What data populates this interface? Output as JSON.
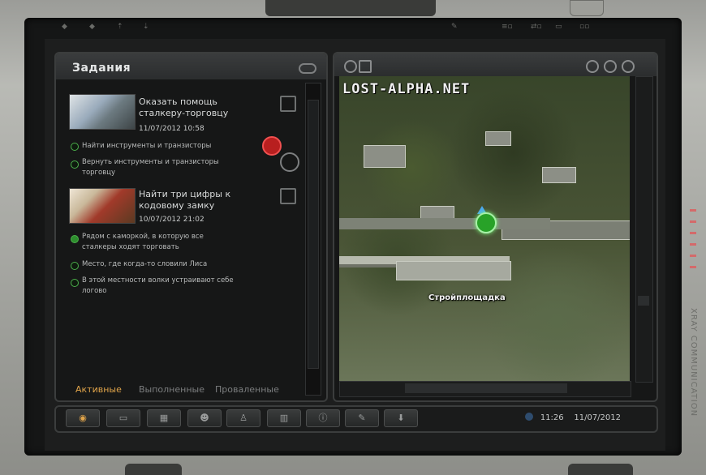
{
  "panel_title": "Задания",
  "watermark": "LOST-ALPHA.NET",
  "map_location_label": "Стройплощадка",
  "tasks": [
    {
      "title_line1": "Оказать помощь",
      "title_line2": "сталкеру-торговцу",
      "datetime": "11/07/2012  10:58",
      "subtasks": [
        {
          "line1": "Найти инструменты и транзисторы",
          "line2": "",
          "active": false
        },
        {
          "line1": "Вернуть инструменты и транзисторы",
          "line2": "торговцу",
          "active": false
        }
      ]
    },
    {
      "title_line1": "Найти три цифры к",
      "title_line2": "кодовому замку",
      "datetime": "10/07/2012  21:02",
      "subtasks": [
        {
          "line1": "Рядом с каморкой, в которую все",
          "line2": "сталкеры ходят торговать",
          "active": true
        },
        {
          "line1": "Место, где когда-то словили Лиса",
          "line2": "",
          "active": false
        },
        {
          "line1": "В этой местности волки устраивают себе",
          "line2": "логово",
          "active": false
        }
      ]
    }
  ],
  "tabs": {
    "active": "Активные",
    "done": "Выполненные",
    "failed": "Проваленные"
  },
  "clock": {
    "time": "11:26",
    "date": "11/07/2012"
  },
  "bottom_buttons": [
    "tasks",
    "map",
    "calendar",
    "contacts",
    "stats",
    "charts",
    "info",
    "tools",
    "download"
  ],
  "device_brand": "XRAY COMMUNICATION",
  "colors": {
    "accent": "#e0a44a",
    "active_dot": "#2d8d2d",
    "panel": "#161717",
    "border": "#3b3d3d"
  }
}
